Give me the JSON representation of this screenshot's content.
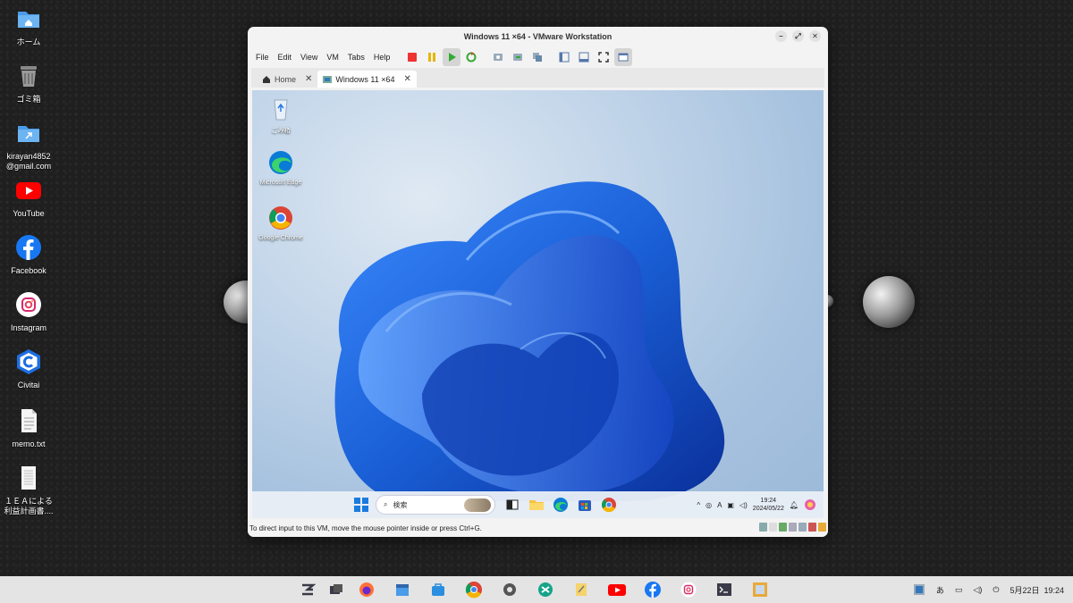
{
  "desktop": {
    "icons": [
      {
        "label": "ホーム",
        "icon": "folder-home-icon"
      },
      {
        "label": "ゴミ箱",
        "icon": "trash-icon"
      },
      {
        "label": "kirayan4852\n@gmail.com",
        "icon": "folder-link-icon"
      },
      {
        "label": "YouTube",
        "icon": "youtube-icon"
      },
      {
        "label": "Facebook",
        "icon": "facebook-icon"
      },
      {
        "label": "Instagram",
        "icon": "instagram-icon"
      },
      {
        "label": "Civitai",
        "icon": "civitai-icon"
      },
      {
        "label": "memo.txt",
        "icon": "text-file-icon"
      },
      {
        "label": "１ＥＡによる\n利益計画書....",
        "icon": "document-icon"
      }
    ]
  },
  "window": {
    "title": "Windows 11 ×64 - VMware Workstation",
    "menu": [
      "File",
      "Edit",
      "View",
      "VM",
      "Tabs",
      "Help"
    ],
    "tabs": [
      {
        "label": "Home",
        "icon": "home-icon"
      },
      {
        "label": "Windows 11 ×64",
        "icon": "vm-icon"
      }
    ],
    "status_text": "To direct input to this VM, move the mouse pointer inside or press Ctrl+G."
  },
  "guest": {
    "icons": [
      {
        "label": "ごみ箱",
        "icon": "recycle-bin-icon"
      },
      {
        "label": "Microsoft Edge",
        "icon": "edge-icon"
      },
      {
        "label": "Google Chrome",
        "icon": "chrome-icon"
      }
    ],
    "search_placeholder": "検索",
    "ime": "A",
    "time": "19:24",
    "date": "2024/05/22"
  },
  "host_tray": {
    "ime": "あ",
    "datetime": "5月22日  19:24"
  },
  "colors": {
    "accent": "#1a5fd6",
    "youtube": "#ff0000",
    "facebook": "#1877f2",
    "folder": "#4a9be8"
  }
}
